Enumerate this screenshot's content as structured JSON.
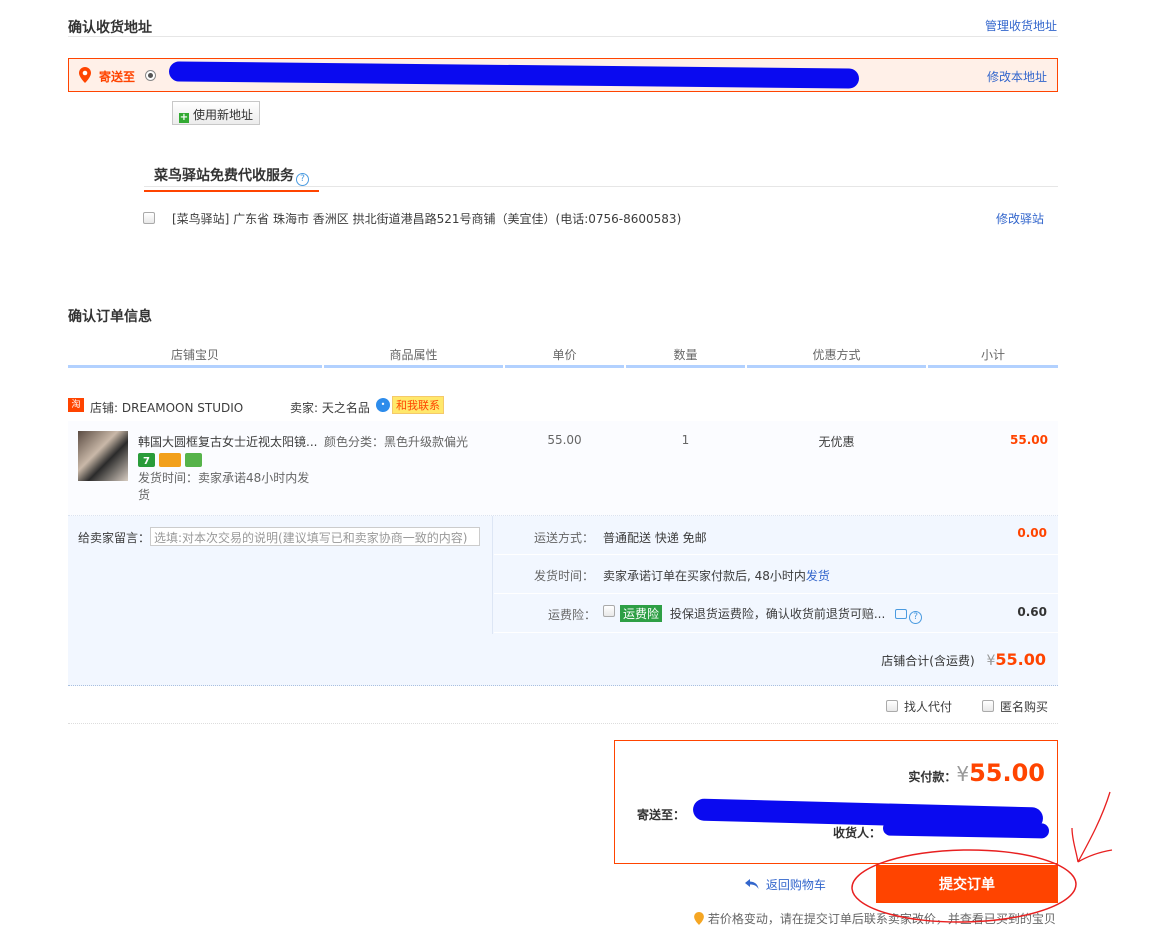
{
  "address": {
    "title": "确认收货地址",
    "manage_link": "管理收货地址",
    "send_to_label": "寄送至",
    "edit_link": "修改本地址",
    "new_address_button": "使用新地址"
  },
  "cainiao": {
    "title": "菜鸟驿站免费代收服务",
    "help_icon": "?",
    "station_text": "[菜鸟驿站] 广东省 珠海市 香洲区 拱北街道港昌路521号商铺（美宜佳）(电话:0756-8600583)",
    "edit_link": "修改驿站"
  },
  "order": {
    "title": "确认订单信息",
    "columns": [
      "店铺宝贝",
      "商品属性",
      "单价",
      "数量",
      "优惠方式",
      "小计"
    ],
    "shop_icon": "淘",
    "shop_label": "店铺: DREAMOON STUDIO",
    "seller_label": "卖家: 天之名品",
    "chat_label": "和我联系",
    "item": {
      "name": "韩国大圆框复古女士近视太阳镜...",
      "ship_time": "发货时间：卖家承诺48小时内发货",
      "attribute": "颜色分类：黑色升级款偏光",
      "price": "55.00",
      "quantity": "1",
      "discount": "无优惠",
      "subtotal": "55.00"
    },
    "message_label": "给卖家留言：",
    "message_placeholder": "选填:对本次交易的说明(建议填写已和卖家协商一致的内容)",
    "shipping_method_label": "运送方式：",
    "shipping_method_value": "普通配送 快递 免邮",
    "shipping_cost": "0.00",
    "ship_time_label": "发货时间：",
    "ship_time_value": "卖家承诺订单在买家付款后, 48小时内",
    "ship_time_link": "发货",
    "insurance_label": "运费险：",
    "insurance_tag": "运费险",
    "insurance_text": "投保退货运费险，确认收货前退货可赔...",
    "insurance_cost": "0.60",
    "shop_total_label": "店铺合计(含运费)",
    "currency": "¥",
    "shop_total": "55.00",
    "proxy_pay": "找人代付",
    "anonymous": "匿名购买"
  },
  "payment": {
    "actual_label": "实付款：",
    "currency": "¥",
    "actual_amount": "55.00",
    "send_to_label": "寄送至：",
    "receiver_label": "收货人：",
    "back_link": "返回购物车",
    "submit_button": "提交订单",
    "notice": "若价格变动，请在提交订单后联系卖家改价，并查看已买到的宝贝"
  },
  "colors": {
    "accent": "#ff4400",
    "link": "#3366cc",
    "header_line": "#b2d1ff",
    "redaction": "#0a0af0",
    "annotation": "#e82020"
  }
}
